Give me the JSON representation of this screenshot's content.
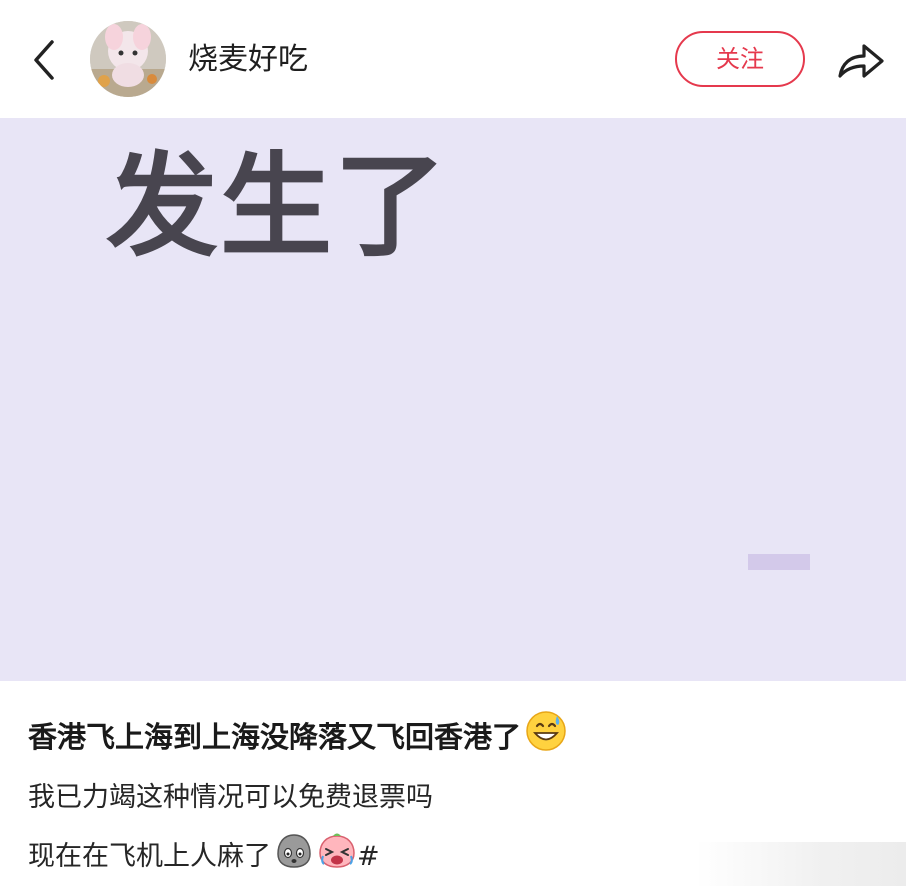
{
  "header": {
    "username": "烧麦好吃",
    "follow_label": "关注"
  },
  "image": {
    "overlay_text": "发生了",
    "background_color": "#e8e5f6"
  },
  "post": {
    "title": "香港飞上海到上海没降落又飞回香港了",
    "title_emoji": "grinning-sweat-emoji",
    "line1": "我已力竭这种情况可以免费退票吗",
    "line2": "现在在飞机上人麻了",
    "line2_trailing": "#",
    "line2_emojis": [
      "ghost-face-emoji",
      "pink-crying-emoji"
    ]
  },
  "colors": {
    "accent": "#e5394d",
    "image_text": "#48454f"
  }
}
